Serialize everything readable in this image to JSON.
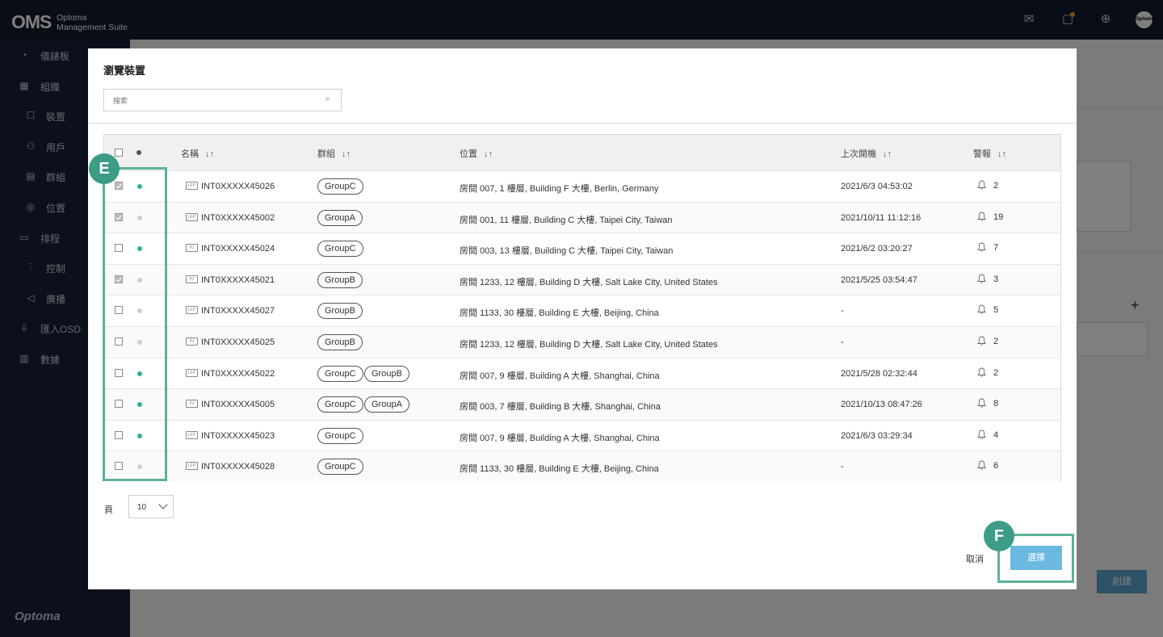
{
  "app": {
    "logo": "OMS",
    "logo_sub_1": "Optoma",
    "logo_sub_2": "Management Suite",
    "brand_footer": "Optoma",
    "avatar_text": "Optoma"
  },
  "sidebar": {
    "items": [
      {
        "label": "儀錶板",
        "icon": "dashboard-icon",
        "glyph": "◔"
      },
      {
        "label": "組織",
        "icon": "organization-icon",
        "glyph": "▦"
      },
      {
        "label": "裝置",
        "icon": "device-icon",
        "glyph": "☐"
      },
      {
        "label": "用戶",
        "icon": "user-icon",
        "glyph": "⚇"
      },
      {
        "label": "群組",
        "icon": "group-icon",
        "glyph": "▤"
      },
      {
        "label": "位置",
        "icon": "location-icon",
        "glyph": "◎"
      },
      {
        "label": "排程",
        "icon": "schedule-icon",
        "glyph": "▭"
      },
      {
        "label": "控制",
        "icon": "control-icon",
        "glyph": "⫶"
      },
      {
        "label": "廣播",
        "icon": "broadcast-icon",
        "glyph": "◁"
      },
      {
        "label": "匯入OSD",
        "icon": "import-osd-icon",
        "glyph": "⇩"
      },
      {
        "label": "數據",
        "icon": "data-icon",
        "glyph": "▥"
      }
    ]
  },
  "background": {
    "create_button": "創建"
  },
  "modal": {
    "title": "瀏覽裝置",
    "search_placeholder": "搜索",
    "columns": {
      "name": "名稱",
      "group": "群組",
      "location": "位置",
      "last_on": "上次開機",
      "alarm": "警報",
      "sort_glyph": "↓↑"
    },
    "rows": [
      {
        "checked": true,
        "online": true,
        "icon_text": "LFP",
        "name": "INT0XXXXX45026",
        "groups": [
          "GroupC"
        ],
        "location": "房間 007, 1 樓層, Building F 大樓, Berlin, Germany",
        "last_on": "2021/6/3 04:53:02",
        "alarms": "2"
      },
      {
        "checked": true,
        "online": false,
        "icon_text": "LFP",
        "name": "INT0XXXXX45002",
        "groups": [
          "GroupA"
        ],
        "location": "房間 001, 11 樓層, Building C 大樓, Taipei City, Taiwan",
        "last_on": "2021/10/11 11:12:16",
        "alarms": "19"
      },
      {
        "checked": false,
        "online": true,
        "icon_text": "PJ",
        "name": "INT0XXXXX45024",
        "groups": [
          "GroupC"
        ],
        "location": "房間 003, 13 樓層, Building C 大樓, Taipei City, Taiwan",
        "last_on": "2021/6/2 03:20:27",
        "alarms": "7"
      },
      {
        "checked": true,
        "online": false,
        "icon_text": "PJ",
        "name": "INT0XXXXX45021",
        "groups": [
          "GroupB"
        ],
        "location": "房間 1233, 12 樓層, Building D 大樓, Salt Lake City, United States",
        "last_on": "2021/5/25 03:54:47",
        "alarms": "3"
      },
      {
        "checked": false,
        "online": false,
        "icon_text": "LFP",
        "name": "INT0XXXXX45027",
        "groups": [
          "GroupB"
        ],
        "location": "房間 1133, 30 樓層, Building E 大樓, Beijing, China",
        "last_on": "-",
        "alarms": "5"
      },
      {
        "checked": false,
        "online": false,
        "icon_text": "PJ",
        "name": "INT0XXXXX45025",
        "groups": [
          "GroupB"
        ],
        "location": "房間 1233, 12 樓層, Building D 大樓, Salt Lake City, United States",
        "last_on": "-",
        "alarms": "2"
      },
      {
        "checked": false,
        "online": true,
        "icon_text": "LFP",
        "name": "INT0XXXXX45022",
        "groups": [
          "GroupC",
          "GroupB"
        ],
        "location": "房間 007, 9 樓層, Building A 大樓, Shanghai, China",
        "last_on": "2021/5/28 02:32:44",
        "alarms": "2"
      },
      {
        "checked": false,
        "online": true,
        "icon_text": "PJ",
        "name": "INT0XXXXX45005",
        "groups": [
          "GroupC",
          "GroupA"
        ],
        "location": "房間 003, 7 樓層, Building B 大樓, Shanghai, China",
        "last_on": "2021/10/13 08:47:26",
        "alarms": "8"
      },
      {
        "checked": false,
        "online": true,
        "icon_text": "LFP",
        "name": "INT0XXXXX45023",
        "groups": [
          "GroupC"
        ],
        "location": "房間 007, 9 樓層, Building A 大樓, Shanghai, China",
        "last_on": "2021/6/3 03:29:34",
        "alarms": "4"
      },
      {
        "checked": false,
        "online": false,
        "icon_text": "LFP",
        "name": "INT0XXXXX45028",
        "groups": [
          "GroupC"
        ],
        "location": "房間 1133, 30 樓層, Building E 大樓, Beijing, China",
        "last_on": "-",
        "alarms": "6"
      }
    ],
    "pager_label": "頁",
    "page_size": "10",
    "cancel_label": "取消",
    "select_label": "選擇"
  },
  "annotations": {
    "badge_e": "E",
    "badge_f": "F"
  },
  "colors": {
    "online": "#28b39a",
    "offline": "#cfcfcf",
    "accent": "#6bb9e0",
    "annotation": "#3d9c86",
    "topbar": "#131a2b"
  }
}
